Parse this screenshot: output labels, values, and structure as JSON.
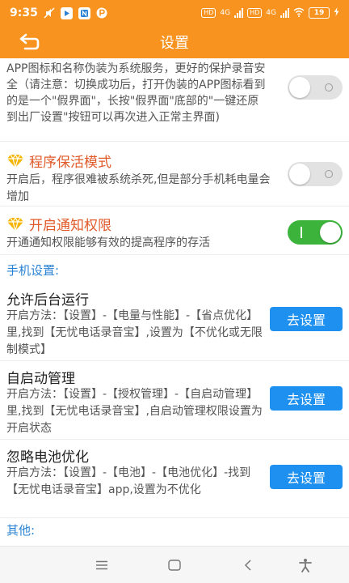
{
  "status_bar": {
    "time": "9:35",
    "notification_icons": [
      "mute-icon",
      "video-icon",
      "n-icon",
      "p-icon"
    ],
    "network_badge": "HD",
    "network_type": "4G",
    "network_badge_2": "HD",
    "network_type_2": "4G",
    "battery": "19"
  },
  "app_bar": {
    "title": "设置"
  },
  "settings": {
    "disguise": {
      "text": "APP图标和名称伪装为系统服务，更好的保护录音安全（请注意：切换成功后，打开伪装的APP图标看到的是一个\"假界面\"，长按\"假界面\"底部的\"一键还原到出厂设置\"按钮可以再次进入正常主界面)",
      "enabled": false
    },
    "keep_alive": {
      "title": "程序保活模式",
      "desc": "开启后，程序很难被系统杀死,但是部分手机耗电量会增加",
      "enabled": false
    },
    "notification": {
      "title": "开启通知权限",
      "desc": "开通通知权限能够有效的提高程序的存活",
      "enabled": true
    }
  },
  "phone_section": {
    "label": "手机设置:",
    "items": [
      {
        "title": "允许后台运行",
        "desc": "开启方法：【设置】-【电量与性能】-【省点优化】里,找到【无忧电话录音宝】,设置为【不优化或无限制模式】",
        "button": "去设置"
      },
      {
        "title": "自启动管理",
        "desc": "开启方法：【设置】-【授权管理】-【自启动管理】里,找到【无忧电话录音宝】,自启动管理权限设置为开启状态",
        "button": "去设置"
      },
      {
        "title": "忽略电池优化",
        "desc": "开启方法：【设置】-【电池】-【电池优化】-找到【无忧电话录音宝】app,设置为不优化",
        "button": "去设置"
      }
    ]
  },
  "other_section": {
    "label": "其他:"
  },
  "colors": {
    "primary": "#f7931e",
    "accent_title": "#e05a2a",
    "section_label": "#2a82d4",
    "button": "#1e90f0",
    "toggle_on": "#3cb43c",
    "toggle_off": "#e2e2e2"
  }
}
